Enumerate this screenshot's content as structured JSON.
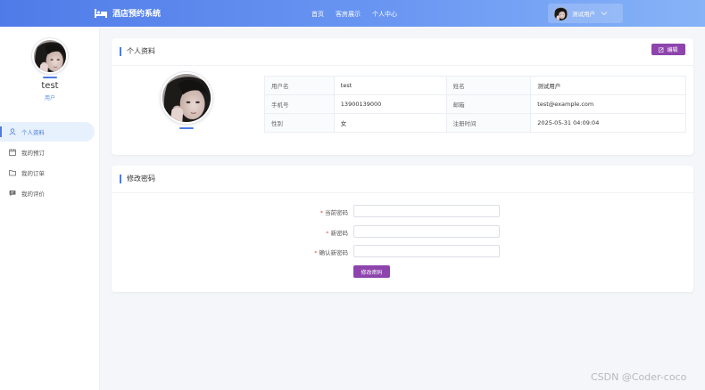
{
  "header": {
    "brand": "酒店预约系统",
    "nav": [
      {
        "label": "首页"
      },
      {
        "label": "客房展示"
      },
      {
        "label": "个人中心"
      }
    ],
    "user_name": "测试用户"
  },
  "sidebar": {
    "username": "test",
    "role": "用户",
    "menu": [
      {
        "label": "个人资料",
        "icon": "user-icon",
        "active": true
      },
      {
        "label": "我的预订",
        "icon": "calendar-icon",
        "active": false
      },
      {
        "label": "我的订单",
        "icon": "folder-icon",
        "active": false
      },
      {
        "label": "我的评价",
        "icon": "comment-icon",
        "active": false
      }
    ]
  },
  "profile": {
    "title": "个人资料",
    "edit_label": "编辑",
    "rows": [
      [
        {
          "k": "用户名",
          "v": "test"
        },
        {
          "k": "姓名",
          "v": "测试用户"
        }
      ],
      [
        {
          "k": "手机号",
          "v": "13900139000"
        },
        {
          "k": "邮箱",
          "v": "test@example.com"
        }
      ],
      [
        {
          "k": "性别",
          "v": "女"
        },
        {
          "k": "注册时间",
          "v": "2025-05-31 04:09:04"
        }
      ]
    ]
  },
  "password": {
    "title": "修改密码",
    "fields": [
      {
        "label": "当前密码",
        "required": "*",
        "value": ""
      },
      {
        "label": "新密码",
        "required": "*",
        "value": ""
      },
      {
        "label": "确认新密码",
        "required": "*",
        "value": ""
      }
    ],
    "submit_label": "修改密码"
  },
  "watermark": "CSDN @Coder-coco",
  "colors": {
    "header_start": "#4f7be8",
    "header_end": "#86b3f7",
    "accent": "#4f7be8",
    "button": "#8e44ad",
    "active_menu_bg": "#e7f1fd"
  }
}
